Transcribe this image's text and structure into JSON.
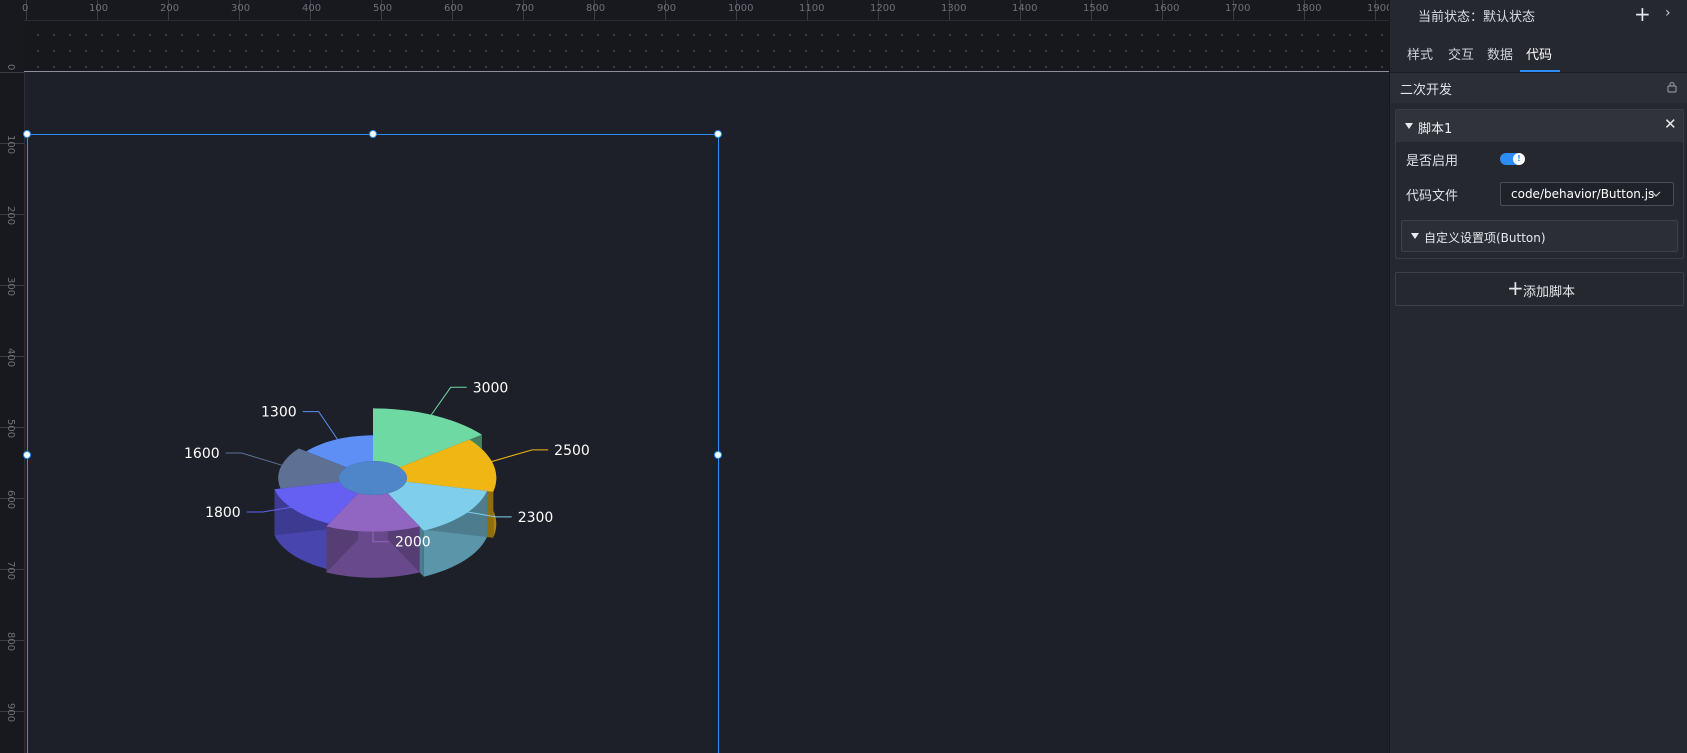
{
  "ruler": {
    "x_labels": [
      "0",
      "100",
      "200",
      "300",
      "400",
      "500",
      "600",
      "700",
      "800",
      "900",
      "1000",
      "1100",
      "1200",
      "1300",
      "1400",
      "1500",
      "1600",
      "1700",
      "1800",
      "1900"
    ],
    "y_labels": [
      "0",
      "100",
      "200",
      "300",
      "400",
      "500",
      "600",
      "700",
      "800",
      "900"
    ]
  },
  "chart_data": {
    "type": "pie",
    "title": "",
    "style": "3d-rose-pie",
    "slices": [
      {
        "label": "3000",
        "value": 3000,
        "color": "#6fd9a4"
      },
      {
        "label": "2500",
        "value": 2500,
        "color": "#f0b714"
      },
      {
        "label": "2300",
        "value": 2300,
        "color": "#7fcfec"
      },
      {
        "label": "2000",
        "value": 2000,
        "color": "#9066c2"
      },
      {
        "label": "1800",
        "value": 1800,
        "color": "#6560f2"
      },
      {
        "label": "1600",
        "value": 1600,
        "color": "#5e7194"
      },
      {
        "label": "1300",
        "value": 1300,
        "color": "#5d8ff5"
      }
    ]
  },
  "panel": {
    "state_label": "当前状态：默认状态",
    "tabs": [
      "样式",
      "交互",
      "数据",
      "代码"
    ],
    "active_tab": "代码",
    "section_title": "二次开发",
    "script": {
      "title": "脚本1",
      "enabled_label": "是否启用",
      "enabled": true,
      "code_file_label": "代码文件",
      "code_file_value": "code/behavior/Button.js",
      "custom_settings_label": "自定义设置项(Button)"
    },
    "add_script_label": "添加脚本"
  },
  "colors": {
    "accent": "#2e8cf5",
    "canvas_bg": "#1d2029",
    "panel_bg": "#25282f"
  }
}
